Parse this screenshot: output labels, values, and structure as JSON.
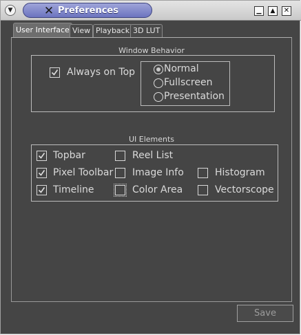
{
  "window": {
    "title": "Preferences"
  },
  "tabs": [
    {
      "label": "User Interface",
      "active": true
    },
    {
      "label": "View",
      "active": false
    },
    {
      "label": "Playback",
      "active": false
    },
    {
      "label": "3D LUT",
      "active": false
    }
  ],
  "window_behavior": {
    "title": "Window Behavior",
    "always_on_top": {
      "label": "Always on Top",
      "checked": true
    },
    "modes": [
      {
        "label": "Normal",
        "selected": true
      },
      {
        "label": "Fullscreen",
        "selected": false
      },
      {
        "label": "Presentation",
        "selected": false
      }
    ]
  },
  "ui_elements": {
    "title": "UI Elements",
    "items": [
      {
        "label": "Topbar",
        "checked": true
      },
      {
        "label": "Pixel Toolbar",
        "checked": true
      },
      {
        "label": "Timeline",
        "checked": true
      },
      {
        "label": "Reel List",
        "checked": false
      },
      {
        "label": "Image Info",
        "checked": false
      },
      {
        "label": "Color Area",
        "checked": false
      },
      {
        "label": "Histogram",
        "checked": false
      },
      {
        "label": "Vectorscope",
        "checked": false
      }
    ]
  },
  "footer": {
    "save_label": "Save"
  },
  "colors": {
    "background": "#454545",
    "title_accent": "#7f86cc"
  }
}
